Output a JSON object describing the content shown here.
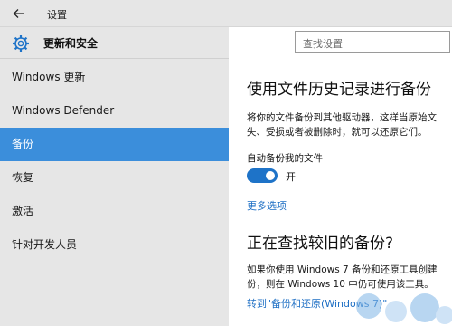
{
  "titlebar": {
    "title": "设置",
    "back_icon": "back-arrow-icon"
  },
  "sidebar": {
    "header": {
      "icon": "gear-icon",
      "label": "更新和安全"
    },
    "items": [
      {
        "label": "Windows 更新",
        "active": false
      },
      {
        "label": "Windows Defender",
        "active": false
      },
      {
        "label": "备份",
        "active": true
      },
      {
        "label": "恢复",
        "active": false
      },
      {
        "label": "激活",
        "active": false
      },
      {
        "label": "针对开发人员",
        "active": false
      }
    ]
  },
  "search": {
    "placeholder": "查找设置"
  },
  "main": {
    "title": "使用文件历史记录进行备份",
    "description_line1": "将你的文件备份到其他驱动器，这样当原始文",
    "description_line2": "失、受损或者被删除时，就可以还原它们。",
    "auto_backup_label": "自动备份我的文件",
    "toggle_state": "开",
    "more_options": "更多选项",
    "section2_title": "正在查找较旧的备份?",
    "section2_line1": "如果你使用 Windows 7 备份和还原工具创建",
    "section2_line2": "份，则在 Windows 10 中仍可使用该工具。",
    "section2_link": "转到\"备份和还原(Windows 7)\""
  },
  "colors": {
    "accent": "#3b8edb",
    "toggle_on": "#1e73c8",
    "link": "#1e6fc4",
    "sidebar_bg": "#e6e6e6"
  }
}
